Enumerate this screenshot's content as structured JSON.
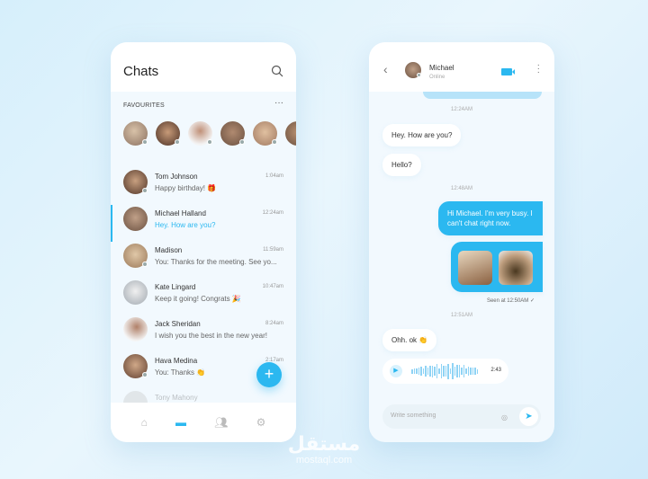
{
  "colors": {
    "accent": "#2bb8f0"
  },
  "chats": {
    "title": "Chats",
    "favourites_label": "FAVOURITES",
    "favourites_count": 6,
    "items": [
      {
        "name": "Tom Johnson",
        "message": "Happy birthday! 🎁",
        "time": "1:04am"
      },
      {
        "name": "Michael Halland",
        "message": "Hey. How are you?",
        "time": "12:24am",
        "selected": true
      },
      {
        "name": "Madison",
        "message": "You: Thanks for the meeting. See yo...",
        "time": "11:59am"
      },
      {
        "name": "Kate Lingard",
        "message": "Keep it going! Congrats 🎉",
        "time": "10:47am"
      },
      {
        "name": "Jack Sheridan",
        "message": "I wish you the best in the new year!",
        "time": "8:24am"
      },
      {
        "name": "Hava Medina",
        "message": "You: Thanks 👏",
        "time": "2:17am"
      },
      {
        "name": "Tony Mahony",
        "message": "",
        "time": ""
      }
    ],
    "nav": [
      "home-icon",
      "chat-icon",
      "contacts-icon",
      "settings-icon"
    ]
  },
  "conversation": {
    "contact": "Michael",
    "status": "Online",
    "stamps": [
      "12:24AM",
      "12:48AM",
      "12:51AM"
    ],
    "messages": {
      "m1": "Hey. How are you?",
      "m2": "Hello?",
      "m3": "Hi Michael. I'm very busy. I can't chat right now.",
      "m4": "Ohh. ok 👏"
    },
    "seen": "Seen at 12:50AM ✓",
    "voice_duration": "2:43",
    "input_placeholder": "Write something"
  },
  "watermark": {
    "arabic": "مستقل",
    "latin": "mostaql.com"
  }
}
